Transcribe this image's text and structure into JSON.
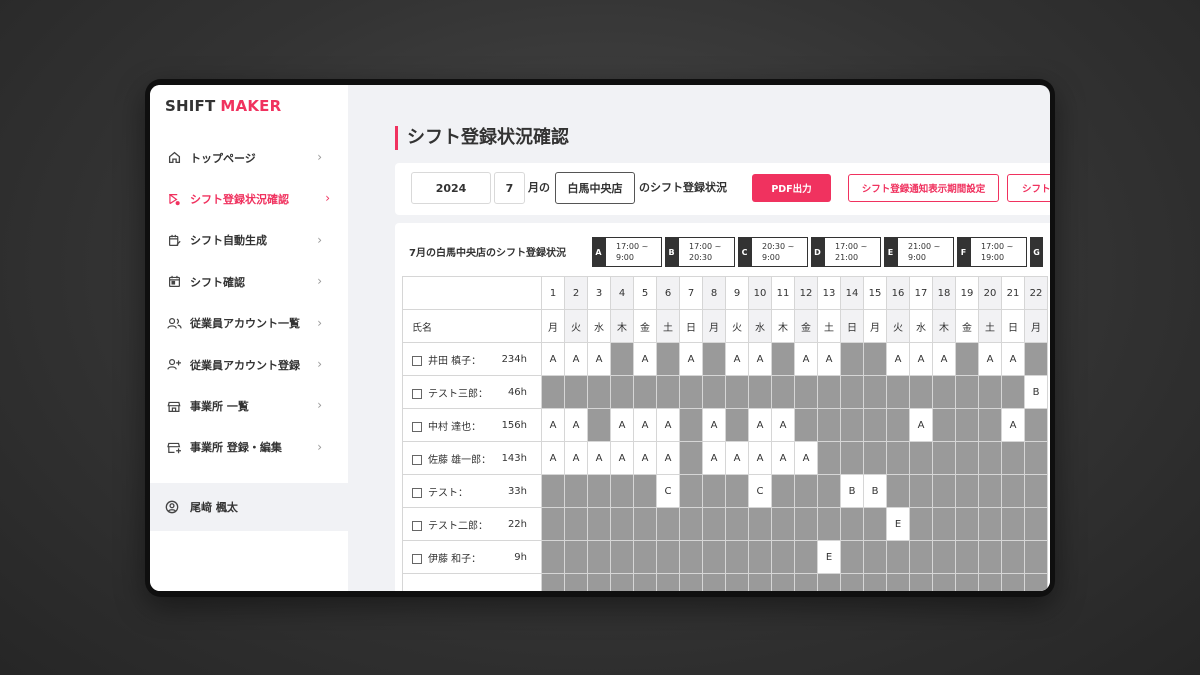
{
  "app": {
    "logo_part1": "SHIFT",
    "logo_part2": "MAKER"
  },
  "sidebar": {
    "items": [
      {
        "label": "トップページ",
        "icon": "home-icon",
        "active": false
      },
      {
        "label": "シフト登録状況確認",
        "icon": "shift-status-icon",
        "active": true
      },
      {
        "label": "シフト自動生成",
        "icon": "calendar-edit-icon",
        "active": false
      },
      {
        "label": "シフト確認",
        "icon": "calendar-icon",
        "active": false
      },
      {
        "label": "従業員アカウント一覧",
        "icon": "users-icon",
        "active": false
      },
      {
        "label": "従業員アカウント登録",
        "icon": "user-add-icon",
        "active": false
      },
      {
        "label": "事業所 一覧",
        "icon": "store-icon",
        "active": false
      },
      {
        "label": "事業所 登録・編集",
        "icon": "store-edit-icon",
        "active": false
      }
    ],
    "user": {
      "name": "尾﨑 楓太",
      "icon": "user-circle-icon"
    }
  },
  "page": {
    "title": "シフト登録状況確認"
  },
  "toolbar": {
    "year": "2024",
    "month": "7",
    "month_suffix": "月の",
    "store": "白馬中央店",
    "status_suffix": "のシフト登録状況",
    "pdf_button": "PDF出力",
    "notify_button": "シフト登録通知表示期間設定",
    "extra_button": "シフト"
  },
  "panel": {
    "title": "7月の白馬中央店のシフト登録状況",
    "legend": [
      {
        "code": "A",
        "start": "17:00 ~",
        "end": "9:00"
      },
      {
        "code": "B",
        "start": "17:00 ~",
        "end": "20:30"
      },
      {
        "code": "C",
        "start": "20:30 ~",
        "end": "9:00"
      },
      {
        "code": "D",
        "start": "17:00 ~",
        "end": "21:00"
      },
      {
        "code": "E",
        "start": "21:00 ~",
        "end": "9:00"
      },
      {
        "code": "F",
        "start": "17:00 ~",
        "end": "19:00"
      },
      {
        "code": "G",
        "start": "",
        "end": ""
      }
    ],
    "name_header": "氏名",
    "days": [
      "1",
      "2",
      "3",
      "4",
      "5",
      "6",
      "7",
      "8",
      "9",
      "10",
      "11",
      "12",
      "13",
      "14",
      "15",
      "16",
      "17",
      "18",
      "19",
      "20",
      "21",
      "22"
    ],
    "weekdays": [
      "月",
      "火",
      "水",
      "木",
      "金",
      "土",
      "日",
      "月",
      "火",
      "水",
      "木",
      "金",
      "土",
      "日",
      "月",
      "火",
      "水",
      "木",
      "金",
      "土",
      "日",
      "月"
    ],
    "employees": [
      {
        "name": "井田 槙子：",
        "hours": "234h",
        "shifts": [
          "A",
          "A",
          "A",
          "-",
          "A",
          "-",
          "A",
          "-",
          "A",
          "A",
          "-",
          "A",
          "A",
          "-",
          "-",
          "A",
          "A",
          "A",
          "-",
          "A",
          "A",
          "-"
        ]
      },
      {
        "name": "テスト三郎：",
        "hours": "46h",
        "shifts": [
          "-",
          "-",
          "-",
          "-",
          "-",
          "-",
          "-",
          "-",
          "-",
          "-",
          "-",
          "-",
          "-",
          "-",
          "-",
          "-",
          "-",
          "-",
          "-",
          "-",
          "-",
          "B"
        ]
      },
      {
        "name": "中村 達也：",
        "hours": "156h",
        "shifts": [
          "A",
          "A",
          "-",
          "A",
          "A",
          "A",
          "-",
          "A",
          "-",
          "A",
          "A",
          "-",
          "-",
          "-",
          "-",
          "-",
          "A",
          "-",
          "-",
          "-",
          "A",
          "-"
        ]
      },
      {
        "name": "佐藤 雄一郎：",
        "hours": "143h",
        "shifts": [
          "A",
          "A",
          "A",
          "A",
          "A",
          "A",
          "-",
          "A",
          "A",
          "A",
          "A",
          "A",
          "-",
          "-",
          "-",
          "-",
          "-",
          "-",
          "-",
          "-",
          "-",
          "-"
        ]
      },
      {
        "name": "テスト：",
        "hours": "33h",
        "shifts": [
          "-",
          "-",
          "-",
          "-",
          "-",
          "C",
          "-",
          "-",
          "-",
          "C",
          "-",
          "-",
          "-",
          "B",
          "B",
          "-",
          "-",
          "-",
          "-",
          "-",
          "-",
          "-"
        ]
      },
      {
        "name": "テスト二郎：",
        "hours": "22h",
        "shifts": [
          "-",
          "-",
          "-",
          "-",
          "-",
          "-",
          "-",
          "-",
          "-",
          "-",
          "-",
          "-",
          "-",
          "-",
          "-",
          "E",
          "-",
          "-",
          "-",
          "-",
          "-",
          "-"
        ]
      },
      {
        "name": "伊藤 和子：",
        "hours": "9h",
        "shifts": [
          "-",
          "-",
          "-",
          "-",
          "-",
          "-",
          "-",
          "-",
          "-",
          "-",
          "-",
          "-",
          "E",
          "-",
          "-",
          "-",
          "-",
          "-",
          "-",
          "-",
          "-",
          "-"
        ]
      },
      {
        "name": "",
        "hours": "",
        "shifts": [
          "-",
          "-",
          "-",
          "-",
          "-",
          "-",
          "-",
          "-",
          "-",
          "-",
          "-",
          "-",
          "-",
          "-",
          "-",
          "-",
          "-",
          "-",
          "-",
          "-",
          "-",
          "-"
        ]
      }
    ]
  },
  "colors": {
    "accent": "#f0325f",
    "unavailable": "#9a9a9a"
  }
}
